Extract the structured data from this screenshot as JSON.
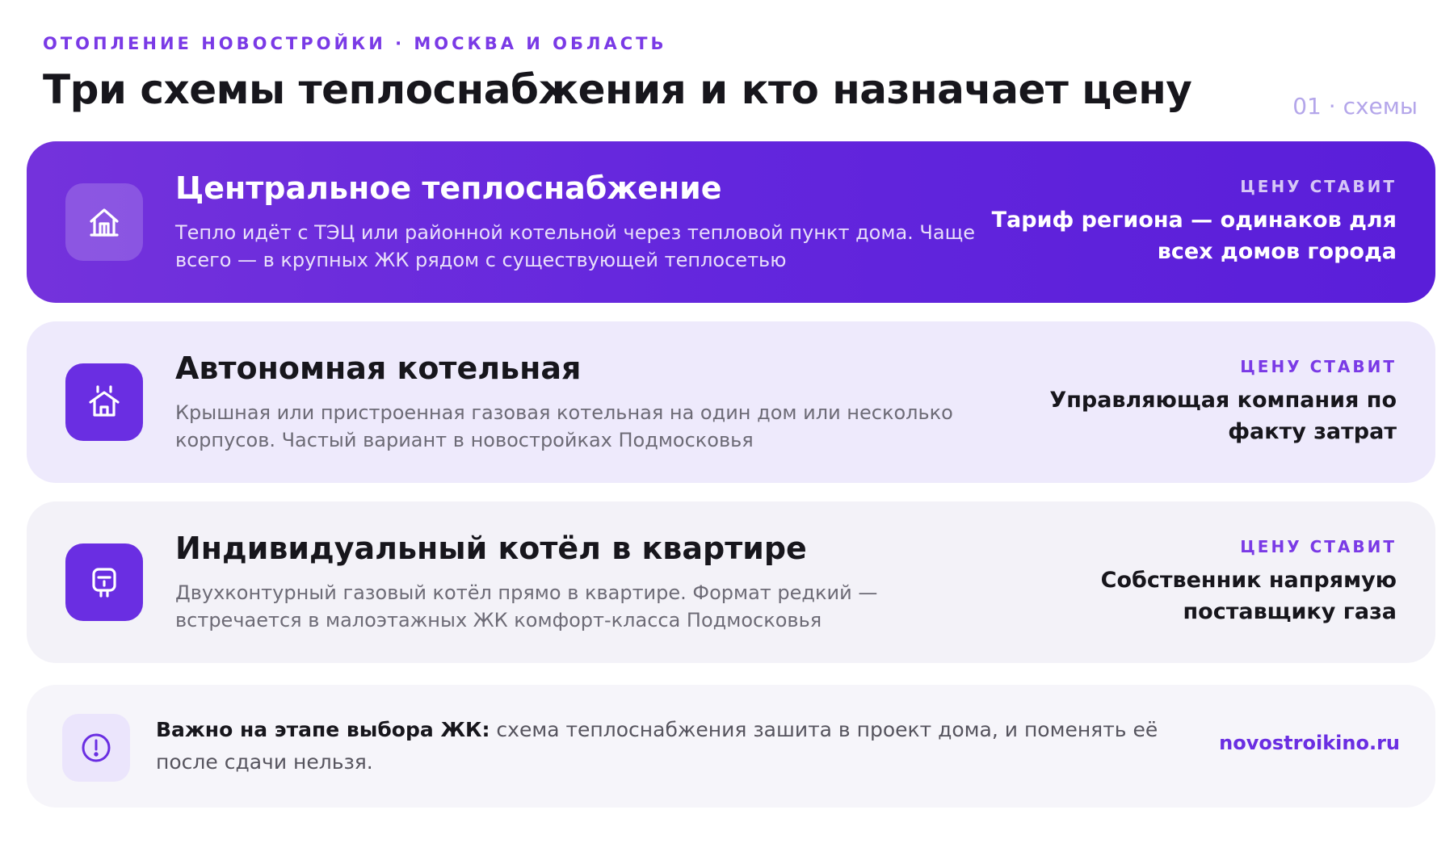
{
  "header": {
    "kicker": "ОТОПЛЕНИЕ НОВОСТРОЙКИ · МОСКВА И ОБЛАСТЬ",
    "title": "Три схемы теплоснабжения и кто назначает цену",
    "page_label": "01 · схемы"
  },
  "cards": [
    {
      "icon": "building-icon",
      "title": "Центральное теплоснабжение",
      "description": "Тепло идёт с ТЭЦ или районной котельной через тепловой пункт дома. Чаще всего — в крупных ЖК рядом с существующей теплосетью",
      "price_label": "ЦЕНУ СТАВИТ",
      "price_value": "Тариф региона — одинаков для всех домов города"
    },
    {
      "icon": "boiler-house-icon",
      "title": "Автономная котельная",
      "description": "Крышная или пристроенная газовая котельная на один дом или несколько корпусов. Частый вариант в новостройках Подмосковья",
      "price_label": "ЦЕНУ СТАВИТ",
      "price_value": "Управляющая компания по факту затрат"
    },
    {
      "icon": "gas-boiler-icon",
      "title": "Индивидуальный котёл в квартире",
      "description": "Двухконтурный газовый котёл прямо в квартире. Формат редкий — встречается в малоэтажных ЖК комфорт-класса Подмосковья",
      "price_label": "ЦЕНУ СТАВИТ",
      "price_value": "Собственник напрямую поставщику газа"
    }
  ],
  "note": {
    "icon": "alert-icon",
    "bold": "Важно на этапе выбора ЖК:",
    "text": " схема теплоснабжения зашита в проект дома, и поменять её после сдачи нельзя.",
    "site": "novostroikino.ru"
  },
  "colors": {
    "accent": "#6a2ee2",
    "card1_bg": "#6326dd",
    "card2_bg": "#eeeafc",
    "card3_bg": "#f3f2f8"
  }
}
